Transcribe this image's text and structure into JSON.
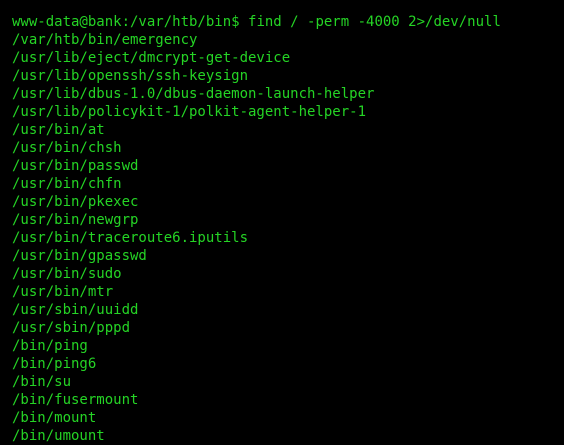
{
  "terminal": {
    "prompt": "www-data@bank:/var/htb/bin$",
    "command": "find / -perm -4000 2>/dev/null",
    "output": [
      "/var/htb/bin/emergency",
      "/usr/lib/eject/dmcrypt-get-device",
      "/usr/lib/openssh/ssh-keysign",
      "/usr/lib/dbus-1.0/dbus-daemon-launch-helper",
      "/usr/lib/policykit-1/polkit-agent-helper-1",
      "/usr/bin/at",
      "/usr/bin/chsh",
      "/usr/bin/passwd",
      "/usr/bin/chfn",
      "/usr/bin/pkexec",
      "/usr/bin/newgrp",
      "/usr/bin/traceroute6.iputils",
      "/usr/bin/gpasswd",
      "/usr/bin/sudo",
      "/usr/bin/mtr",
      "/usr/sbin/uuidd",
      "/usr/sbin/pppd",
      "/bin/ping",
      "/bin/ping6",
      "/bin/su",
      "/bin/fusermount",
      "/bin/mount",
      "/bin/umount"
    ]
  },
  "colors": {
    "background": "#000000",
    "text": "#25d425"
  }
}
